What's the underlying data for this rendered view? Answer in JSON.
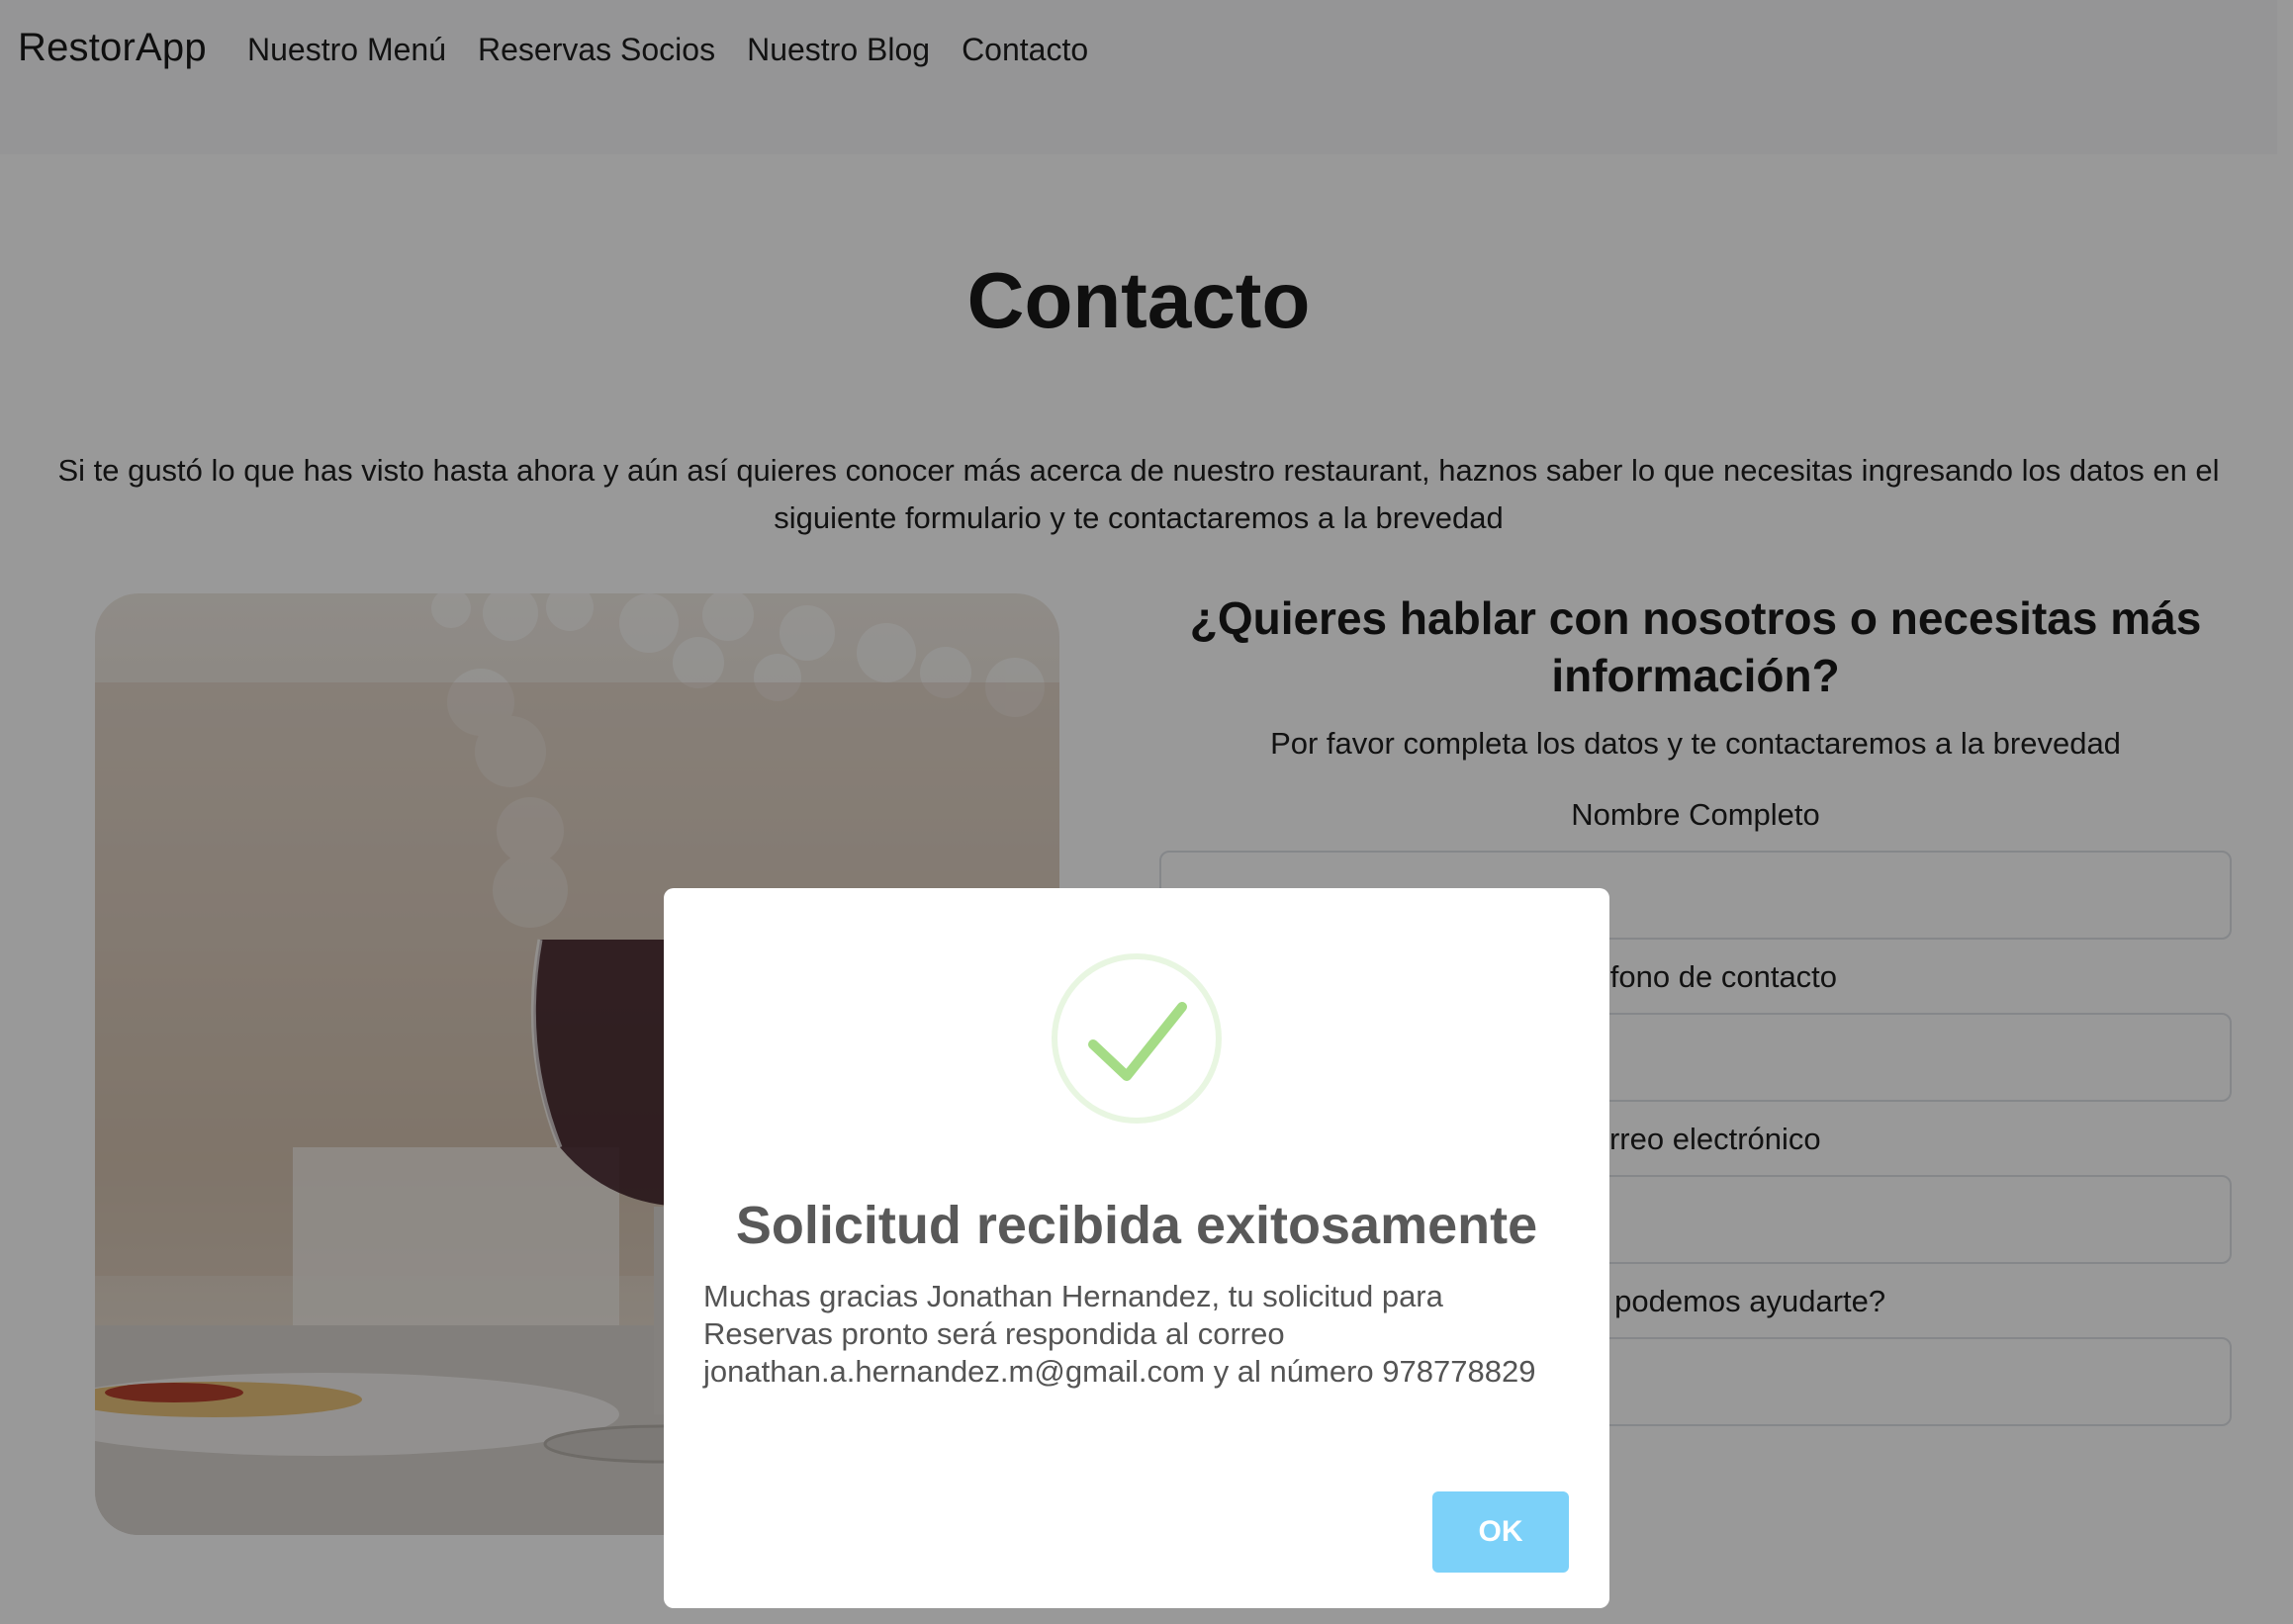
{
  "navbar": {
    "brand": "RestorApp",
    "links": [
      "Nuestro Menú",
      "Reservas Socios",
      "Nuestro Blog",
      "Contacto"
    ]
  },
  "main": {
    "title": "Contacto",
    "intro": "Si te gustó lo que has visto hasta ahora y aún así quieres conocer más acerca de nuestro restaurant, haznos saber lo que necesitas ingresando los datos en el siguiente formulario y te contactaremos a la brevedad"
  },
  "form": {
    "heading": "¿Quieres hablar con nosotros o necesitas más información?",
    "subheading": "Por favor completa los datos y te contactaremos a la brevedad",
    "fields": {
      "name_label": "Nombre Completo",
      "phone_label": "Teléfono de contacto",
      "email_label": "Correo electrónico",
      "help_label": "¿Cómo podemos ayudarte?"
    }
  },
  "modal": {
    "icon": "checkmark-icon",
    "title": "Solicitud recibida exitosamente",
    "message": "Muchas gracias Jonathan Hernandez, tu solicitud para Reservas pronto será respondida al correo jonathan.a.hernandez.m@gmail.com y al número 978778829",
    "ok_label": "OK"
  },
  "colors": {
    "success_green": "#a5dc86",
    "ok_button": "#7cd1f9",
    "overlay": "rgba(0,0,0,0.4)"
  }
}
